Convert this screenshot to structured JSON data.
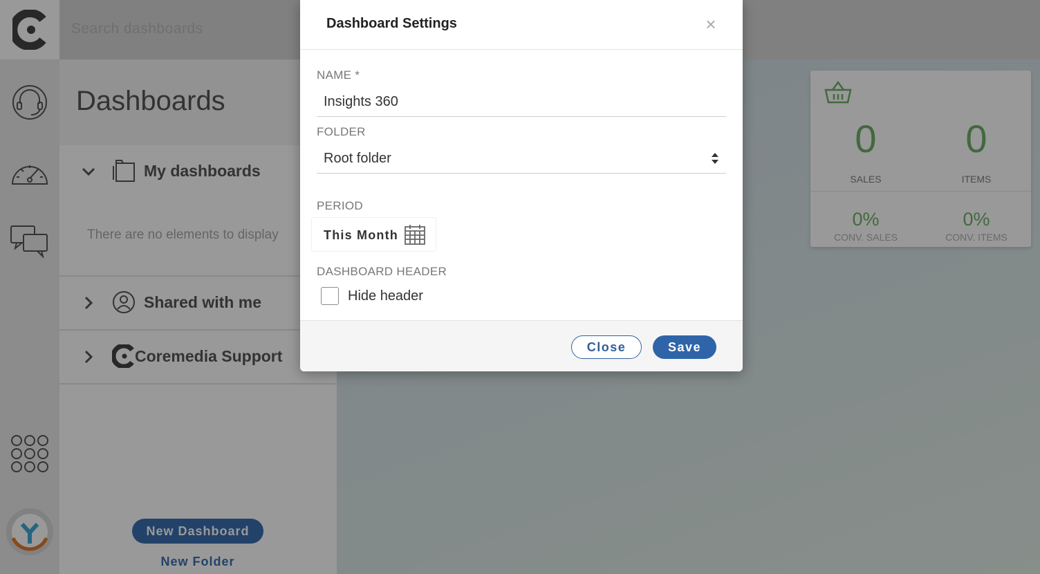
{
  "topbar": {
    "search_placeholder": "Search dashboards",
    "logo_icon": "coremedia-logo-icon"
  },
  "rail": {
    "icons": [
      "headset-icon",
      "speedometer-icon",
      "chat-bubbles-icon",
      "apps-grid-icon",
      "user-avatar-icon"
    ]
  },
  "panel": {
    "title": "Dashboards",
    "sections": [
      {
        "label": "My dashboards",
        "icon": "folder-icon",
        "expanded": true
      },
      {
        "label": "Shared with me",
        "icon": "shared-user-icon",
        "expanded": false
      },
      {
        "label": "Coremedia Support",
        "icon": "coremedia-logo-icon",
        "expanded": false
      }
    ],
    "empty_message": "There are no elements to display",
    "new_dashboard_label": "New Dashboard",
    "new_folder_label": "New Folder"
  },
  "widget": {
    "icon": "basket-icon",
    "sales_value": "0",
    "sales_label": "SALES",
    "items_value": "0",
    "items_label": "ITEMS",
    "conv_sales_value": "0%",
    "conv_sales_label": "CONV. SALES",
    "conv_items_value": "0%",
    "conv_items_label": "CONV. ITEMS"
  },
  "modal": {
    "title": "Dashboard Settings",
    "close_icon": "×",
    "name_label": "NAME *",
    "name_value": "Insights 360",
    "folder_label": "FOLDER",
    "folder_value": "Root folder",
    "period_label": "PERIOD",
    "period_value": "This Month",
    "header_label": "DASHBOARD HEADER",
    "hide_header_label": "Hide header",
    "hide_header_checked": false,
    "close_button": "Close",
    "save_button": "Save"
  },
  "colors": {
    "primary": "#2f64a8",
    "accent_green": "#6fb06a",
    "overlay": "rgba(0,0,0,0.4)"
  }
}
